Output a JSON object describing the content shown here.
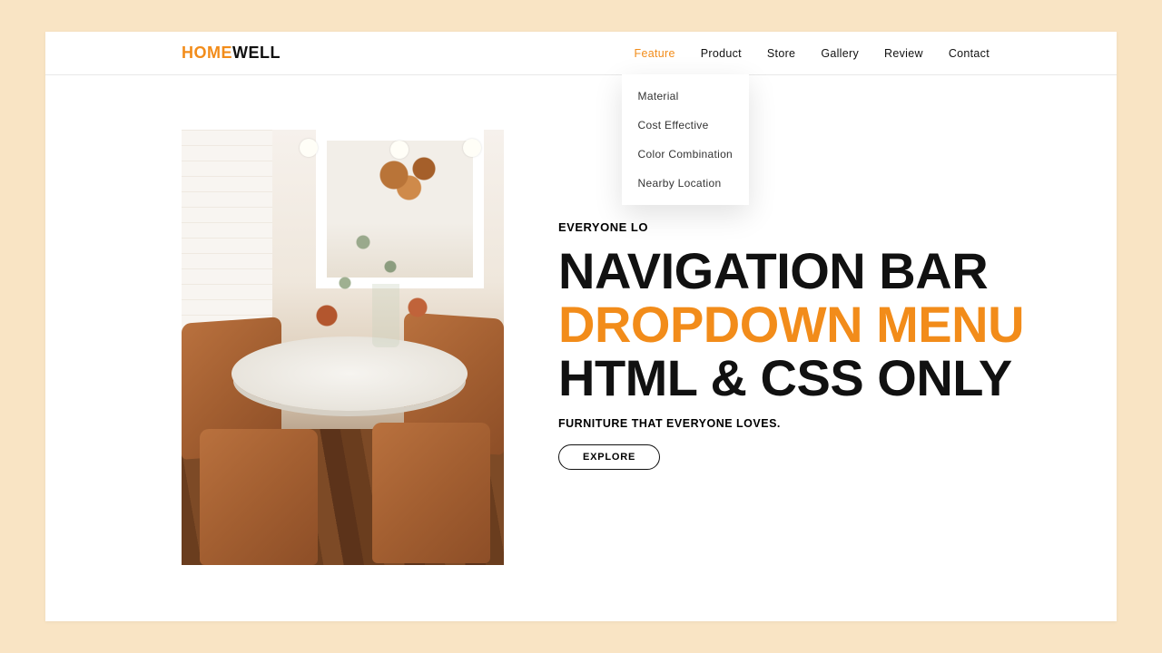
{
  "logo": {
    "part1": "HOME",
    "part2": "WELL"
  },
  "nav": {
    "items": [
      {
        "label": "Feature",
        "active": true
      },
      {
        "label": "Product"
      },
      {
        "label": "Store"
      },
      {
        "label": "Gallery"
      },
      {
        "label": "Review"
      },
      {
        "label": "Contact"
      }
    ],
    "dropdown": [
      {
        "label": "Material"
      },
      {
        "label": "Cost Effective"
      },
      {
        "label": "Color Combination"
      },
      {
        "label": "Nearby Location"
      }
    ]
  },
  "hero": {
    "eyebrow": "EVERYONE LO",
    "headline1": "NAVIGATION BAR",
    "headline2": "DROPDOWN MENU",
    "headline3": "HTML & CSS ONLY",
    "tagline": "FURNITURE THAT EVERYONE LOVES.",
    "cta": "EXPLORE"
  },
  "colors": {
    "accent": "#f28c1a"
  }
}
